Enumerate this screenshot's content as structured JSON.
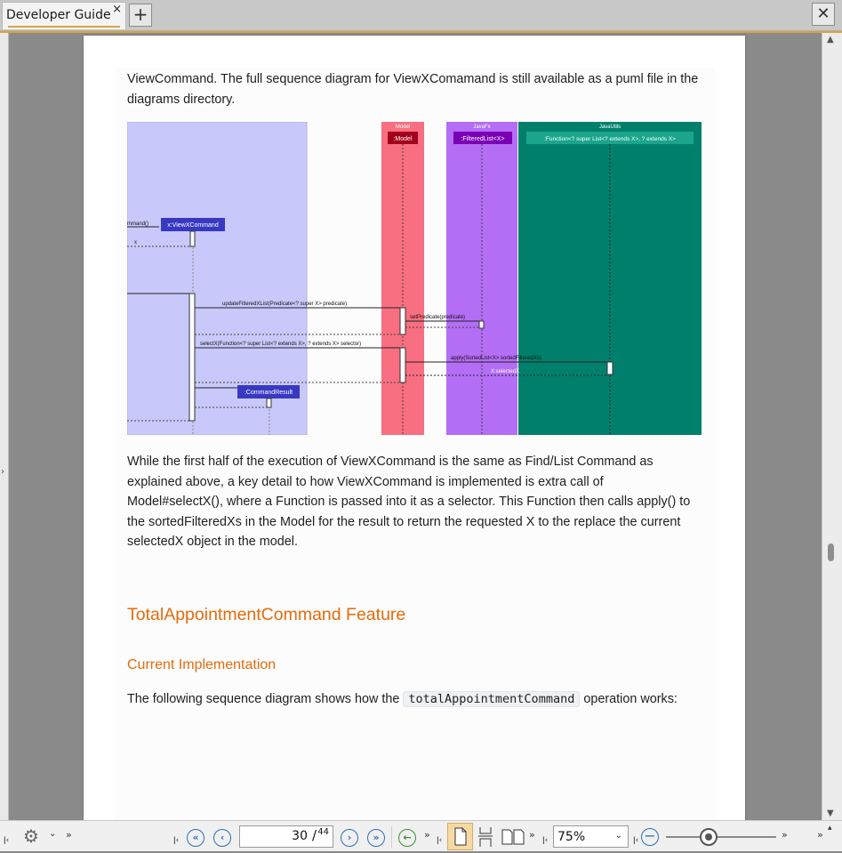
{
  "tab": {
    "title": "Developer Guide",
    "close": "×"
  },
  "new_tab": "+",
  "window_close": "✕",
  "document": {
    "para1": "ViewCommand. The full sequence diagram for ViewXComamand is still available as a puml file in the diagrams directory.",
    "para2": "While the first half of the execution of ViewXCommand is the same as Find/List Command as explained above, a key detail to how ViewXCommand is implemented is extra call of Model#selectX(), where a Function is passed into it as a selector. This Function then calls apply() to the sortedFilteredXs in the Model for the result to return the requested X to the replace the current selectedX object in the model.",
    "h2": "TotalAppointmentCommand Feature",
    "h3": "Current Implementation",
    "para3_before": "The following sequence diagram shows how the",
    "para3_code": "totalAppointmentCommand",
    "para3_after": "operation works:"
  },
  "diagram": {
    "lanes": [
      {
        "title": "Model",
        "participant": ":Model",
        "color": "#f76f80"
      },
      {
        "title": "JavaFx",
        "participant": ":FilteredList<X>",
        "color": "#b46df5"
      },
      {
        "title": "JavaUtils",
        "participant": ":Function<? super List<? extends X>, ? extends X>",
        "color": "#00806c"
      }
    ],
    "messages": {
      "m_cmd": "mmand()",
      "view_cmd": "x:ViewXCommand",
      "x_ret": "x",
      "update": "updateFilteredXList(Predicate<? super X> predicate)",
      "set_pred": "setPredicate(predicate)",
      "selectx": "selectX(Function<? super List<? extends X>, ? extends X> selector)",
      "apply": "apply(SortedList<X> sortedFilteredXs)",
      "selected": "X:selectedX",
      "result": ":CommandResult"
    }
  },
  "toolbar": {
    "page_current": "30",
    "page_sep": "/",
    "page_total": "44",
    "zoom": "75%",
    "settings_icon": "gear-icon"
  },
  "colors": {
    "accent": "#d9a441",
    "heading": "#e46c0a",
    "nav_blue": "#2d6fb8"
  }
}
